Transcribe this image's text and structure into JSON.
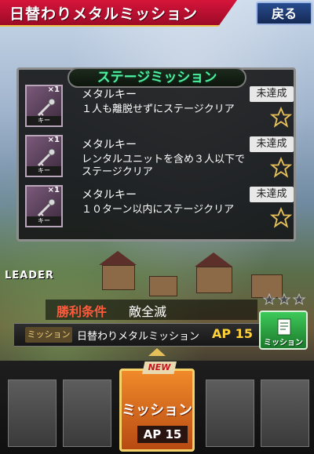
{
  "header": {
    "title": "日替わりメタルミッション",
    "back_label": "戻る"
  },
  "panel": {
    "title": "ステージミッション",
    "rows": [
      {
        "item_name": "メタルキー",
        "item_count": "×1",
        "item_caption": "キー",
        "status": "未達成",
        "condition": "１人も離脱せずにステージクリア"
      },
      {
        "item_name": "メタルキー",
        "item_count": "×1",
        "item_caption": "キー",
        "status": "未達成",
        "condition": "レンタルユニットを含め３人以下でステージクリア"
      },
      {
        "item_name": "メタルキー",
        "item_count": "×1",
        "item_caption": "キー",
        "status": "未達成",
        "condition": "１０ターン以内にステージクリア"
      }
    ]
  },
  "leader_label": "LEADER",
  "victory": {
    "label": "勝利条件",
    "value": "敵全滅"
  },
  "mission_bar": {
    "tag": "ミッション",
    "name": "日替わりメタルミッション",
    "ap": "AP 15"
  },
  "mission_side": {
    "label": "ミッション"
  },
  "mission_card": {
    "new_label": "NEW",
    "label": "ミッション",
    "ap": "AP 15"
  },
  "colors": {
    "title_red": "#d6143a",
    "accent_gold": "#f5d36a",
    "panel_title_green": "#4ef0a0"
  }
}
